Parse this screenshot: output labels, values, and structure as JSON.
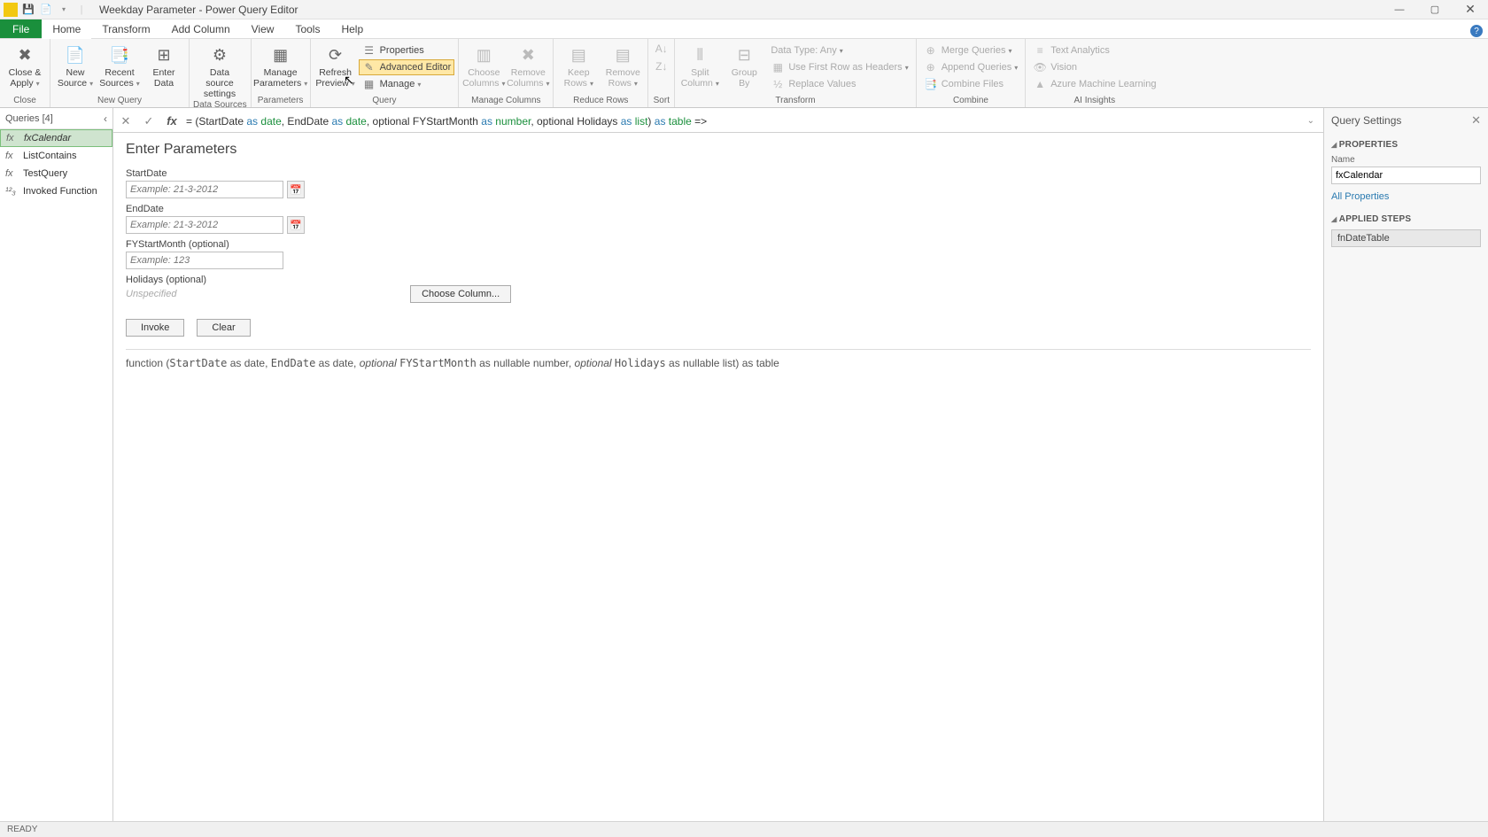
{
  "title": "Weekday Parameter - Power Query Editor",
  "tabs": {
    "file": "File",
    "home": "Home",
    "transform": "Transform",
    "addcol": "Add Column",
    "view": "View",
    "tools": "Tools",
    "help": "Help"
  },
  "ribbon": {
    "close_group": {
      "close_apply": "Close &\nApply",
      "label": "Close"
    },
    "newquery_group": {
      "new_source": "New\nSource",
      "recent_sources": "Recent\nSources",
      "enter_data": "Enter\nData",
      "label": "New Query"
    },
    "datasources_group": {
      "data_source_settings": "Data source\nsettings",
      "label": "Data Sources"
    },
    "parameters_group": {
      "manage_parameters": "Manage\nParameters",
      "label": "Parameters"
    },
    "query_group": {
      "refresh_preview": "Refresh\nPreview",
      "properties": "Properties",
      "advanced_editor": "Advanced Editor",
      "manage": "Manage",
      "label": "Query"
    },
    "managecols_group": {
      "choose_columns": "Choose\nColumns",
      "remove_columns": "Remove\nColumns",
      "label": "Manage Columns"
    },
    "reducerows_group": {
      "keep_rows": "Keep\nRows",
      "remove_rows": "Remove\nRows",
      "label": "Reduce Rows"
    },
    "sort_group": {
      "label": "Sort"
    },
    "transform_group": {
      "split_column": "Split\nColumn",
      "group_by": "Group\nBy",
      "data_type": "Data Type: Any",
      "first_row_headers": "Use First Row as Headers",
      "replace_values": "Replace Values",
      "label": "Transform"
    },
    "combine_group": {
      "merge": "Merge Queries",
      "append": "Append Queries",
      "combine_files": "Combine Files",
      "label": "Combine"
    },
    "ai_group": {
      "text_analytics": "Text Analytics",
      "vision": "Vision",
      "azure_ml": "Azure Machine Learning",
      "label": "AI Insights"
    }
  },
  "queries": {
    "header": "Queries [4]",
    "items": [
      {
        "icon": "fx",
        "name": "fxCalendar"
      },
      {
        "icon": "fx",
        "name": "ListContains"
      },
      {
        "icon": "fx",
        "name": "TestQuery"
      },
      {
        "icon": "¹²₃",
        "name": "Invoked Function"
      }
    ]
  },
  "formula": {
    "prefix": "= (StartDate ",
    "as1": "as",
    "t1": "date",
    "mid1": ", EndDate ",
    "as2": "as",
    "t2": "date",
    "mid2": ", optional FYStartMonth ",
    "as3": "as",
    "t3": "number",
    "mid3": ", optional Holidays ",
    "as4": "as",
    "t4": "list",
    "mid4": ") ",
    "as5": "as",
    "t5": "table",
    "suffix": " =>"
  },
  "params": {
    "title": "Enter Parameters",
    "start_label": "StartDate",
    "start_placeholder": "Example: 21-3-2012",
    "end_label": "EndDate",
    "end_placeholder": "Example: 21-3-2012",
    "fy_label": "FYStartMonth (optional)",
    "fy_placeholder": "Example: 123",
    "holidays_label": "Holidays (optional)",
    "unspecified": "Unspecified",
    "choose_column": "Choose Column...",
    "invoke": "Invoke",
    "clear": "Clear"
  },
  "signature": {
    "pre": "function (",
    "p1": "StartDate",
    "a1": " as date, ",
    "p2": "EndDate",
    "a2": " as date, ",
    "opt1": "optional ",
    "p3": "FYStartMonth",
    "a3": " as nullable number, ",
    "opt2": "optional ",
    "p4": "Holidays",
    "a4": " as nullable list) as table"
  },
  "settings": {
    "title": "Query Settings",
    "properties": "PROPERTIES",
    "name_label": "Name",
    "name_value": "fxCalendar",
    "all_properties": "All Properties",
    "applied_steps": "APPLIED STEPS",
    "step1": "fnDateTable"
  },
  "status": "READY"
}
